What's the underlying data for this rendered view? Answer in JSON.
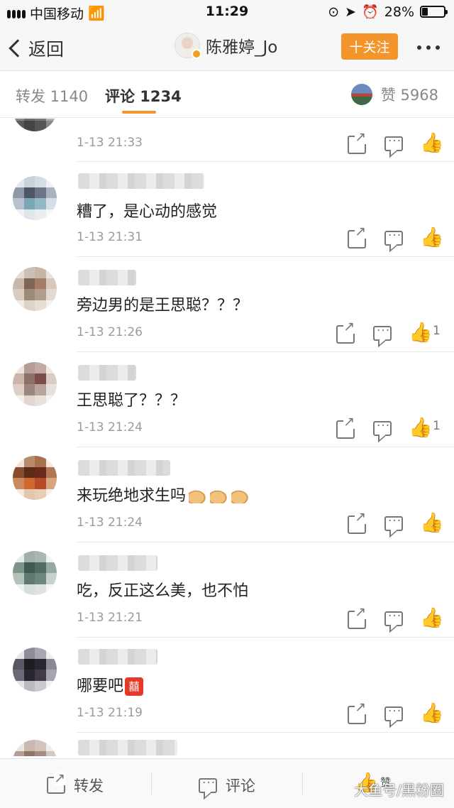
{
  "status_bar": {
    "carrier": "中国移动",
    "time": "11:29",
    "battery": "28%"
  },
  "nav": {
    "back_label": "返回",
    "user_name": "陈雅婷_Jo",
    "follow_label": "十关注"
  },
  "tabs": {
    "repost": "转发 1140",
    "comment": "评论 1234",
    "likes": "赞 5968"
  },
  "comments": [
    {
      "text": "",
      "time": "1-13 21:33",
      "likes": ""
    },
    {
      "text": "糟了，是心动的感觉",
      "time": "1-13 21:31",
      "likes": ""
    },
    {
      "text": "旁边男的是王思聪？？？",
      "time": "1-13 21:26",
      "likes": "1"
    },
    {
      "text": "王思聪了？？？",
      "time": "1-13 21:24",
      "likes": "1"
    },
    {
      "text": "来玩绝地求生吗",
      "time": "1-13 21:24",
      "likes": ""
    },
    {
      "text": "吃，反正这么美，也不怕",
      "time": "1-13 21:21",
      "likes": ""
    },
    {
      "text": "哪要吧",
      "time": "1-13 21:19",
      "likes": ""
    }
  ],
  "bottom_bar": {
    "repost": "转发",
    "comment": "评论",
    "like": "赞",
    "watermark": "大鱼号/黑粉圈"
  },
  "colors": {
    "accent": "#f4952b",
    "emoji_red": "#e53a2a"
  },
  "icons": [
    "back-chevron-icon",
    "more-icon",
    "share-icon",
    "comment-icon",
    "like-icon",
    "verified-icon"
  ]
}
